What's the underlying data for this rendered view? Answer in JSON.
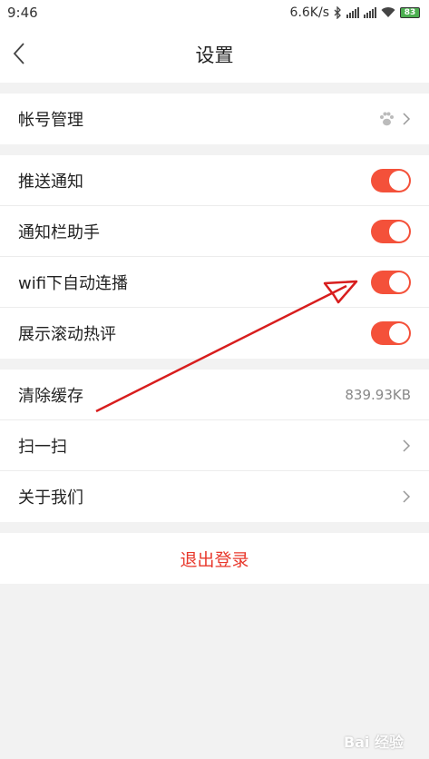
{
  "status_bar": {
    "time": "9:46",
    "speed": "6.6K/s",
    "battery": "83",
    "icons": [
      "bluetooth-icon",
      "signal-icon",
      "signal-icon",
      "wifi-icon",
      "battery-icon"
    ]
  },
  "header": {
    "title": "设置"
  },
  "account": {
    "label": "帐号管理",
    "icon": "baidu-paw-icon"
  },
  "toggles": [
    {
      "label": "推送通知",
      "on": true
    },
    {
      "label": "通知栏助手",
      "on": true
    },
    {
      "label": "wifi下自动连播",
      "on": true
    },
    {
      "label": "展示滚动热评",
      "on": true
    }
  ],
  "misc": {
    "cache_label": "清除缓存",
    "cache_size": "839.93KB",
    "scan_label": "扫一扫",
    "about_label": "关于我们"
  },
  "logout_label": "退出登录",
  "watermark": "Bai 经验",
  "colors": {
    "accent": "#f4513a",
    "logout": "#e8382c",
    "annotation_arrow": "#d81e1e"
  }
}
